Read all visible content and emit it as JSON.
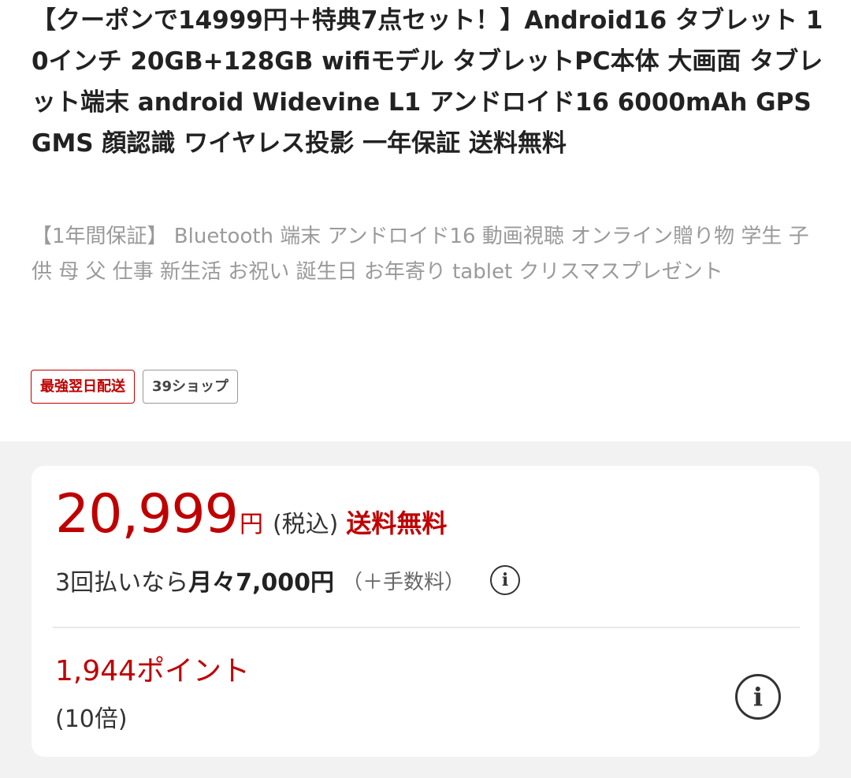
{
  "product": {
    "title": "【クーポンで14999円＋特典7点セット！】Android16 タブレット 10インチ 20GB+128GB wifiモデル タブレットPC本体 大画面 タブレット端末 android Widevine L1 アンドロイド16 6000mAh GPS GMS 顔認識 ワイヤレス投影 一年保証 送料無料",
    "subtitle": "【1年間保証】 Bluetooth 端末 アンドロイド16 動画視聴 オンライン贈り物 学生 子供 母 父 仕事 新生活 お祝い 誕生日 お年寄り tablet クリスマスプレゼント"
  },
  "badges": {
    "delivery": "最強翌日配送",
    "shop": "39ショップ"
  },
  "price": {
    "value": "20,999",
    "currency": "円",
    "tax_label": "(税込)",
    "shipping_label": "送料無料"
  },
  "installment": {
    "prefix": "3回払いなら",
    "amount": "月々7,000円",
    "fee_note": "（＋手数料）"
  },
  "points": {
    "amount": "1,944ポイント",
    "multiplier": "(10倍)"
  },
  "icons": {
    "info_glyph": "i"
  },
  "colors": {
    "accent_red": "#bf0000",
    "background": "#f2f2f2",
    "card": "#ffffff"
  }
}
